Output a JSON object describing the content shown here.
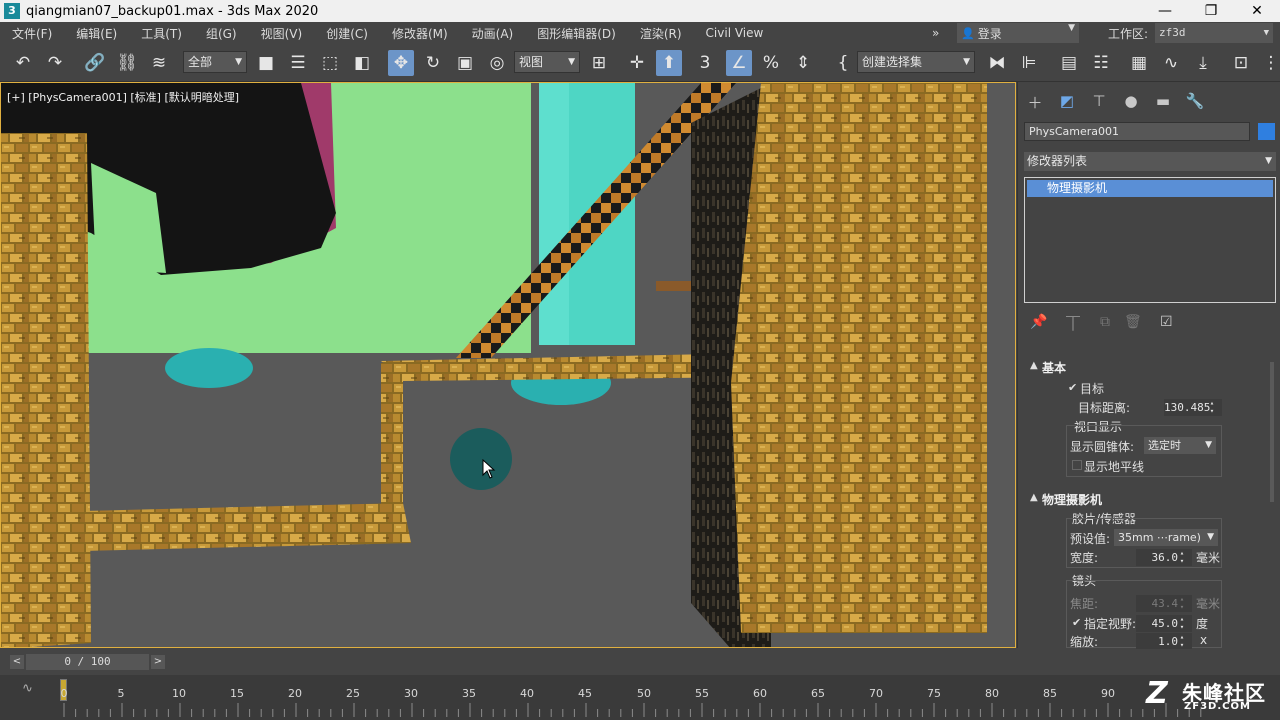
{
  "window": {
    "title": "qiangmian07_backup01.max - 3ds Max 2020",
    "app_icon": "3",
    "controls": [
      "—",
      "❐",
      "✕"
    ]
  },
  "menu": {
    "items": [
      "文件(F)",
      "编辑(E)",
      "工具(T)",
      "组(G)",
      "视图(V)",
      "创建(C)",
      "修改器(M)",
      "动画(A)",
      "图形编辑器(D)",
      "渲染(R)",
      "Civil View"
    ],
    "overflow": "»",
    "login": "登录",
    "workspace_label": "工作区:",
    "workspace_value": "zf3d"
  },
  "toolbar": {
    "selection_filter": "全部",
    "coord_system": "视图",
    "named_selection": "创建选择集"
  },
  "viewport": {
    "label": "[+] [PhysCamera001] [标准] [默认明暗处理]"
  },
  "command_panel": {
    "object_name": "PhysCamera001",
    "object_color": "#2f7fe0",
    "modifier_list": "修改器列表",
    "stack_item": "物理摄影机",
    "rollout_basic": {
      "title": "基本",
      "target_label": "目标",
      "target_checked": true,
      "target_distance_label": "目标距离:",
      "target_distance": "130.485",
      "viewport_display_label": "视口显示",
      "show_cone_label": "显示圆锥体:",
      "show_cone_value": "选定时",
      "show_horizon_label": "显示地平线",
      "show_horizon_checked": false
    },
    "rollout_physcam": {
      "title": "物理摄影机",
      "film_group": "胶片/传感器",
      "preset_label": "预设值:",
      "preset_value": "35mm ⋯rame)",
      "width_label": "宽度:",
      "width_value": "36.0",
      "width_unit": "毫米",
      "lens_group": "镜头",
      "focal_label": "焦距:",
      "focal_value": "43.4",
      "focal_unit": "毫米",
      "fov_label": "指定视野:",
      "fov_checked": true,
      "fov_value": "45.0",
      "fov_unit": "度",
      "zoom_label": "缩放:",
      "zoom_value": "1.0",
      "zoom_unit": "x"
    }
  },
  "timeline": {
    "frame_display": "0 / 100",
    "ticks": [
      "5",
      "10",
      "15",
      "20",
      "25",
      "30",
      "35",
      "40",
      "45",
      "50",
      "55",
      "60",
      "65",
      "70",
      "75",
      "80",
      "85",
      "90"
    ],
    "first_tick": "0"
  },
  "watermark": {
    "logo": "Z",
    "name": "朱峰社区",
    "url": "ZF3D.COM"
  }
}
